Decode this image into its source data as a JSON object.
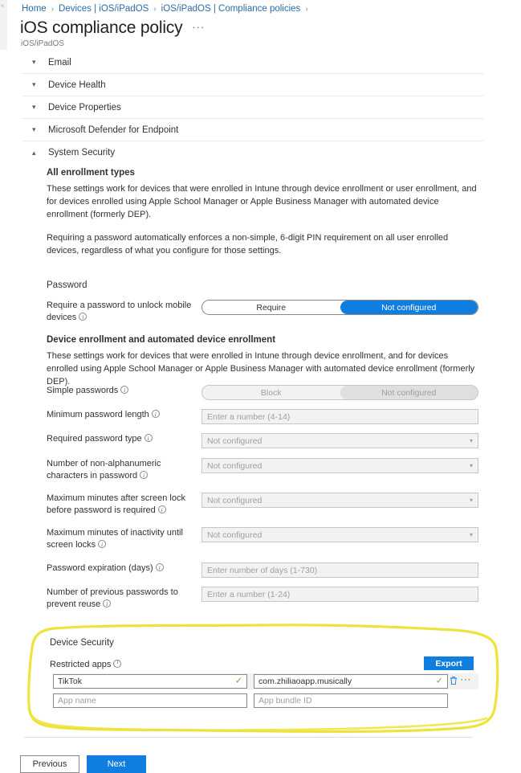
{
  "breadcrumb": {
    "items": [
      "Home",
      "Devices | iOS/iPadOS",
      "iOS/iPadOS | Compliance policies"
    ],
    "separator": "›"
  },
  "header": {
    "title": "iOS compliance policy",
    "subtitle": "iOS/iPadOS",
    "ellipsis": "···"
  },
  "accordion": {
    "items": [
      {
        "label": "Email",
        "expanded": false,
        "chevron": "chevron-down-icon"
      },
      {
        "label": "Device Health",
        "expanded": false,
        "chevron": "chevron-down-icon"
      },
      {
        "label": "Device Properties",
        "expanded": false,
        "chevron": "chevron-down-icon"
      },
      {
        "label": "Microsoft Defender for Endpoint",
        "expanded": false,
        "chevron": "chevron-down-icon"
      },
      {
        "label": "System Security",
        "expanded": true,
        "chevron": "chevron-up-icon"
      }
    ]
  },
  "system_security": {
    "all_enrollment": {
      "heading": "All enrollment types",
      "para1": "These settings work for devices that were enrolled in Intune through device enrollment or user enrollment, and for devices enrolled using Apple School Manager or Apple Business Manager with automated device enrollment (formerly DEP).",
      "para2": "Requiring a password automatically enforces a non-simple, 6-digit PIN requirement on all user enrolled devices, regardless of what you configure for those settings."
    },
    "password_group": {
      "heading": "Password",
      "require_password": {
        "label": "Require a password to unlock mobile devices",
        "options": [
          "Require",
          "Not configured"
        ],
        "selected": "Not configured"
      }
    },
    "device_enrollment": {
      "heading": "Device enrollment and automated device enrollment",
      "para": "These settings work for devices that were enrolled in Intune through device enrollment, and for devices enrolled using Apple School Manager or Apple Business Manager with automated device enrollment (formerly DEP)."
    },
    "fields": {
      "simple_passwords": {
        "label": "Simple passwords",
        "options": [
          "Block",
          "Not configured"
        ],
        "selected": "Not configured",
        "disabled": true
      },
      "minimum_password_length": {
        "label": "Minimum password length",
        "placeholder": "Enter a number (4-14)",
        "value": ""
      },
      "required_password_type": {
        "label": "Required password type",
        "value": "Not configured"
      },
      "non_alphanumeric": {
        "label": "Number of non-alphanumeric characters in password",
        "value": "Not configured"
      },
      "max_minutes_screen_lock": {
        "label": "Maximum minutes after screen lock before password is required",
        "value": "Not configured"
      },
      "max_minutes_inactivity": {
        "label": "Maximum minutes of inactivity until screen locks",
        "value": "Not configured"
      },
      "password_expiration": {
        "label": "Password expiration (days)",
        "placeholder": "Enter number of days (1-730)",
        "value": ""
      },
      "previous_passwords": {
        "label": "Number of previous passwords to prevent reuse",
        "placeholder": "Enter a number (1-24)",
        "value": ""
      }
    },
    "device_security": {
      "heading": "Device Security",
      "restricted_apps_label": "Restricted apps",
      "export_button": "Export",
      "columns": {
        "name_placeholder": "App name",
        "bundle_placeholder": "App bundle ID"
      },
      "rows": [
        {
          "app_name": "TikTok",
          "bundle_id": "com.zhiliaoapp.musically",
          "filled": true,
          "name_valid": true,
          "bundle_valid": true
        },
        {
          "app_name": "",
          "bundle_id": "",
          "filled": false,
          "name_valid": false,
          "bundle_valid": false
        }
      ]
    }
  },
  "footer": {
    "previous": "Previous",
    "next": "Next"
  },
  "icons": {
    "check": "✓",
    "trash": "🗑",
    "more": "···",
    "chevron_down": "⌄",
    "chevron_up": "⌃"
  },
  "colors": {
    "accent_blue": "#0f7ede",
    "highlight_yellow": "#ece43c",
    "check_green": "#6aab4a",
    "link_blue": "#2b6ca3"
  }
}
